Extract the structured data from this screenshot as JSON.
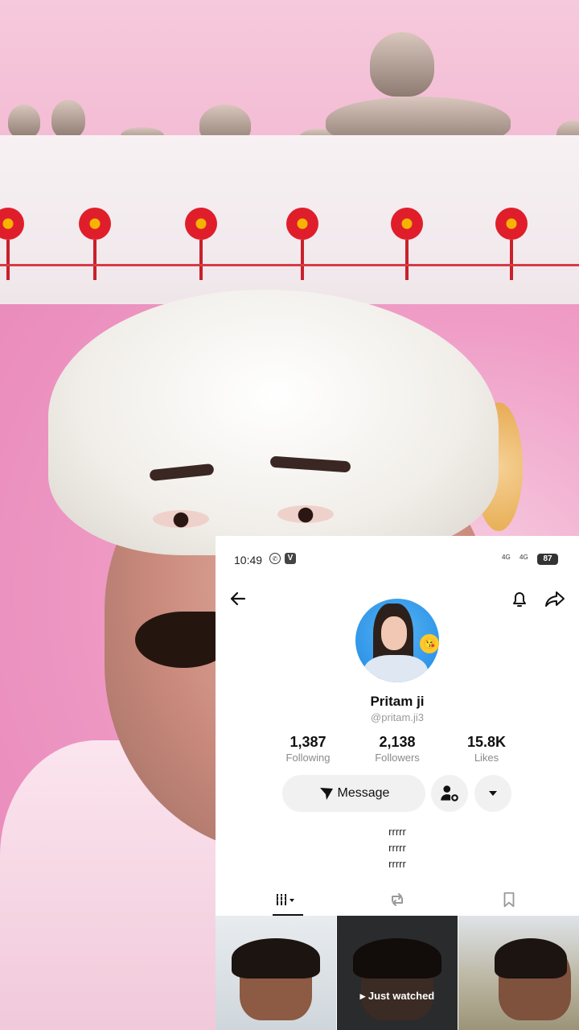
{
  "status_bar": {
    "time": "10:49",
    "whatsapp_icon": "whatsapp-icon",
    "v_badge": "V",
    "net1": "4G",
    "net2": "4G",
    "battery": "87"
  },
  "profile": {
    "name": "Pritam ji",
    "handle": "@pritam.ji3",
    "avatar_emoji": "😘",
    "stats": [
      {
        "value": "1,387",
        "label": "Following"
      },
      {
        "value": "2,138",
        "label": "Followers"
      },
      {
        "value": "15.8K",
        "label": "Likes"
      }
    ],
    "message_label": "Message",
    "bio": [
      "rrrrr",
      "rrrrr",
      "rrrrr"
    ]
  },
  "tabs": [
    {
      "icon": "videos-grid-icon",
      "active": true
    },
    {
      "icon": "repost-icon",
      "active": false
    },
    {
      "icon": "bookmark-icon",
      "active": false
    }
  ],
  "videos": [
    {
      "overlay": ""
    },
    {
      "overlay": "Just watched"
    },
    {
      "overlay": ""
    }
  ],
  "colors": {
    "background_pink": "#ef9cc6",
    "button_gray": "#f1f1f2",
    "text_dark": "#111111",
    "text_muted": "#8a8a8a"
  }
}
